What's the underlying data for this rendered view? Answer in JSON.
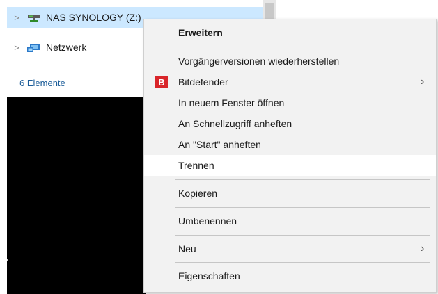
{
  "nav": {
    "items": [
      {
        "label": "NAS SYNOLOGY (Z:)",
        "icon": "network-drive-icon",
        "selected": true
      },
      {
        "label": "Netzwerk",
        "icon": "network-icon",
        "selected": false
      }
    ],
    "status": "6 Elemente"
  },
  "menu": {
    "items": [
      {
        "label": "Erweitern"
      },
      {
        "label": "Vorgängerversionen wiederherstellen"
      },
      {
        "label": "Bitdefender",
        "icon_text": "B"
      },
      {
        "label": "In neuem Fenster öffnen"
      },
      {
        "label": "An Schnellzugriff anheften"
      },
      {
        "label": "An \"Start\" anheften"
      },
      {
        "label": "Trennen"
      },
      {
        "label": "Kopieren"
      },
      {
        "label": "Umbenennen"
      },
      {
        "label": "Neu"
      },
      {
        "label": "Eigenschaften"
      }
    ],
    "submenu_arrow": "›"
  },
  "colors": {
    "selection": "#cce8ff",
    "menu_bg": "#f2f2f2",
    "bitdefender_red": "#d9252a",
    "status_text": "#1c5d99"
  }
}
